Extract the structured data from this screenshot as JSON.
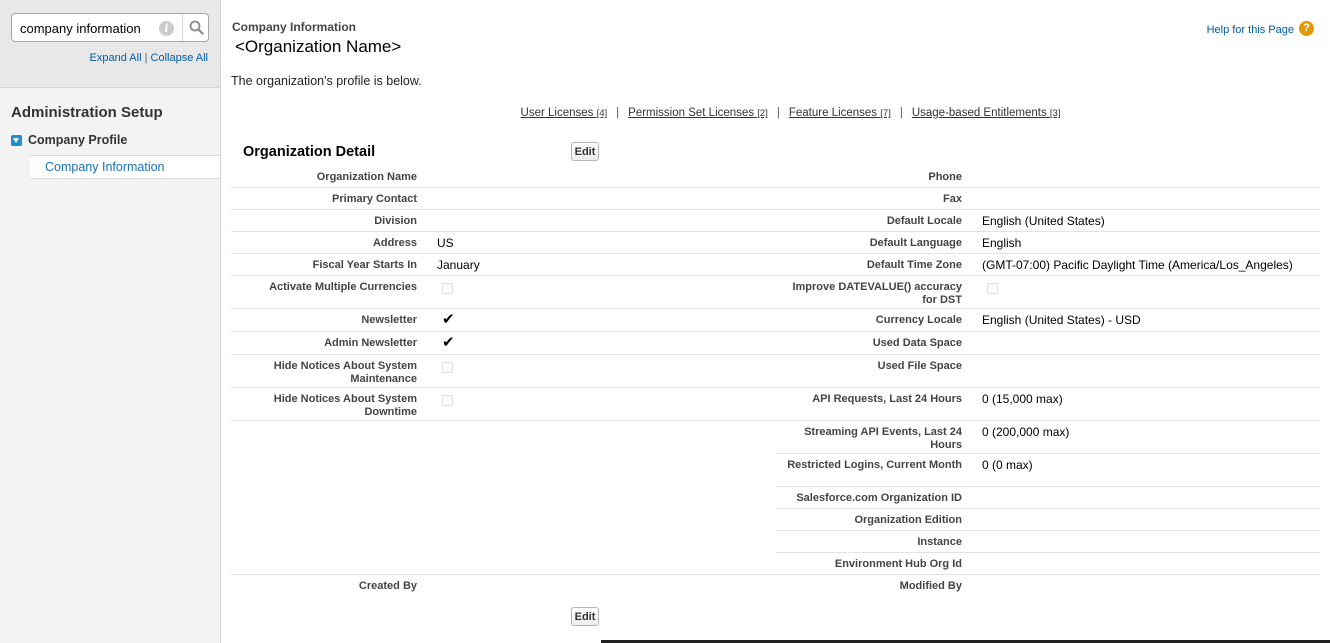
{
  "sidebar": {
    "search": {
      "value": "company information"
    },
    "expand_all": "Expand All",
    "link_sep": "|",
    "collapse_all": "Collapse All",
    "section_title": "Administration Setup",
    "tree": {
      "parent_label": "Company Profile",
      "child_label": "Company Information"
    }
  },
  "header": {
    "breadcrumb": "Company Information",
    "title": "<Organization Name>",
    "help_link": "Help for this Page",
    "help_icon_glyph": "?"
  },
  "intro_text": "The organization's profile is below.",
  "related_links": [
    {
      "label": "User Licenses",
      "count": "[4]"
    },
    {
      "label": "Permission Set Licenses",
      "count": "[2]"
    },
    {
      "label": "Feature Licenses",
      "count": "[7]"
    },
    {
      "label": "Usage-based Entitlements",
      "count": "[3]"
    }
  ],
  "related_sep": "|",
  "detail": {
    "section_title": "Organization Detail",
    "edit_label": "Edit",
    "left_fields": {
      "organization_name": {
        "label": "Organization Name",
        "value": ""
      },
      "primary_contact": {
        "label": "Primary Contact",
        "value": ""
      },
      "division": {
        "label": "Division",
        "value": ""
      },
      "address": {
        "label": "Address",
        "value": "US"
      },
      "fiscal_year": {
        "label": "Fiscal Year Starts In",
        "value": "January"
      },
      "multi_currencies": {
        "label": "Activate Multiple Currencies",
        "checked": false
      },
      "newsletter": {
        "label": "Newsletter",
        "checked": true
      },
      "admin_newsletter": {
        "label": "Admin Newsletter",
        "checked": true
      },
      "hide_maintenance": {
        "label": "Hide Notices About System Maintenance",
        "checked": false
      },
      "hide_downtime": {
        "label": "Hide Notices About System Downtime",
        "checked": false
      },
      "created_by": {
        "label": "Created By",
        "value": ""
      }
    },
    "right_fields": {
      "phone": {
        "label": "Phone",
        "value": ""
      },
      "fax": {
        "label": "Fax",
        "value": ""
      },
      "default_locale": {
        "label": "Default Locale",
        "value": "English (United States)"
      },
      "default_language": {
        "label": "Default Language",
        "value": "English"
      },
      "default_time_zone": {
        "label": "Default Time Zone",
        "value": "(GMT-07:00) Pacific Daylight Time (America/Los_Angeles)"
      },
      "datevalue_accuracy": {
        "label": "Improve DATEVALUE() accuracy for DST",
        "checked": false
      },
      "currency_locale": {
        "label": "Currency Locale",
        "value": "English (United States) - USD"
      },
      "used_data_space": {
        "label": "Used Data Space",
        "value": ""
      },
      "used_file_space": {
        "label": "Used File Space",
        "value": ""
      },
      "api_requests": {
        "label": "API Requests, Last 24 Hours",
        "value": "0 (15,000 max)"
      },
      "streaming_api": {
        "label": "Streaming API Events, Last 24 Hours",
        "value": "0 (200,000 max)"
      },
      "restricted_logins": {
        "label": "Restricted Logins, Current Month",
        "value": "0 (0 max)"
      },
      "org_id": {
        "label": "Salesforce.com Organization ID",
        "value": ""
      },
      "org_edition": {
        "label": "Organization Edition",
        "value": ""
      },
      "instance": {
        "label": "Instance",
        "value": ""
      },
      "env_hub_org_id": {
        "label": "Environment Hub Org Id",
        "value": ""
      },
      "modified_by": {
        "label": "Modified By",
        "value": ""
      }
    },
    "check_glyph": "✔"
  }
}
